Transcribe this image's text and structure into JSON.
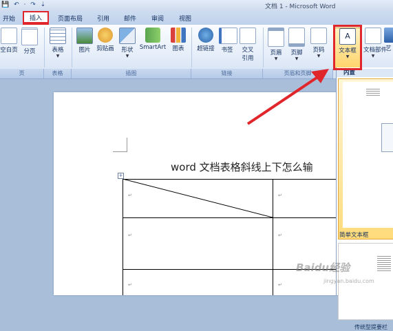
{
  "window": {
    "title": "文档 1 - Microsoft Word",
    "quick_access": "💾 ↶ · ↷ ⇣"
  },
  "tabs": [
    "开始",
    "插入",
    "页面布局",
    "引用",
    "邮件",
    "审阅",
    "视图"
  ],
  "active_tab": "插入",
  "ribbon": {
    "buttons": {
      "cover_page": "空白页",
      "blank_page": "分页",
      "table": "表格",
      "picture": "图片",
      "clipart": "剪贴画",
      "shapes": "形状",
      "smartart": "SmartArt",
      "chart": "图表",
      "hyperlink": "超链接",
      "bookmark": "书签",
      "cross_ref_1": "交叉",
      "cross_ref_2": "引用",
      "header": "页眉",
      "footer": "页脚",
      "page_number": "页码",
      "textbox": "文本框",
      "quickparts": "文档部件",
      "wordart": "艺"
    },
    "groups": {
      "pages": "页",
      "tables": "表格",
      "illustrations": "插图",
      "links": "链接",
      "header_footer": "页眉和页脚"
    }
  },
  "document": {
    "heading": "word 文档表格斜线上下怎么输",
    "para_mark": "↵"
  },
  "gallery": {
    "section_title": "内置",
    "items": [
      "简单文本框",
      "传统型提要栏"
    ]
  },
  "watermark": {
    "main": "Baidu经验",
    "sub": "jingyan.baidu.com"
  },
  "colors": {
    "highlight": "#e0262b",
    "ribbon_bg": "#dfe9f7",
    "doc_bg": "#a9bfd9"
  }
}
